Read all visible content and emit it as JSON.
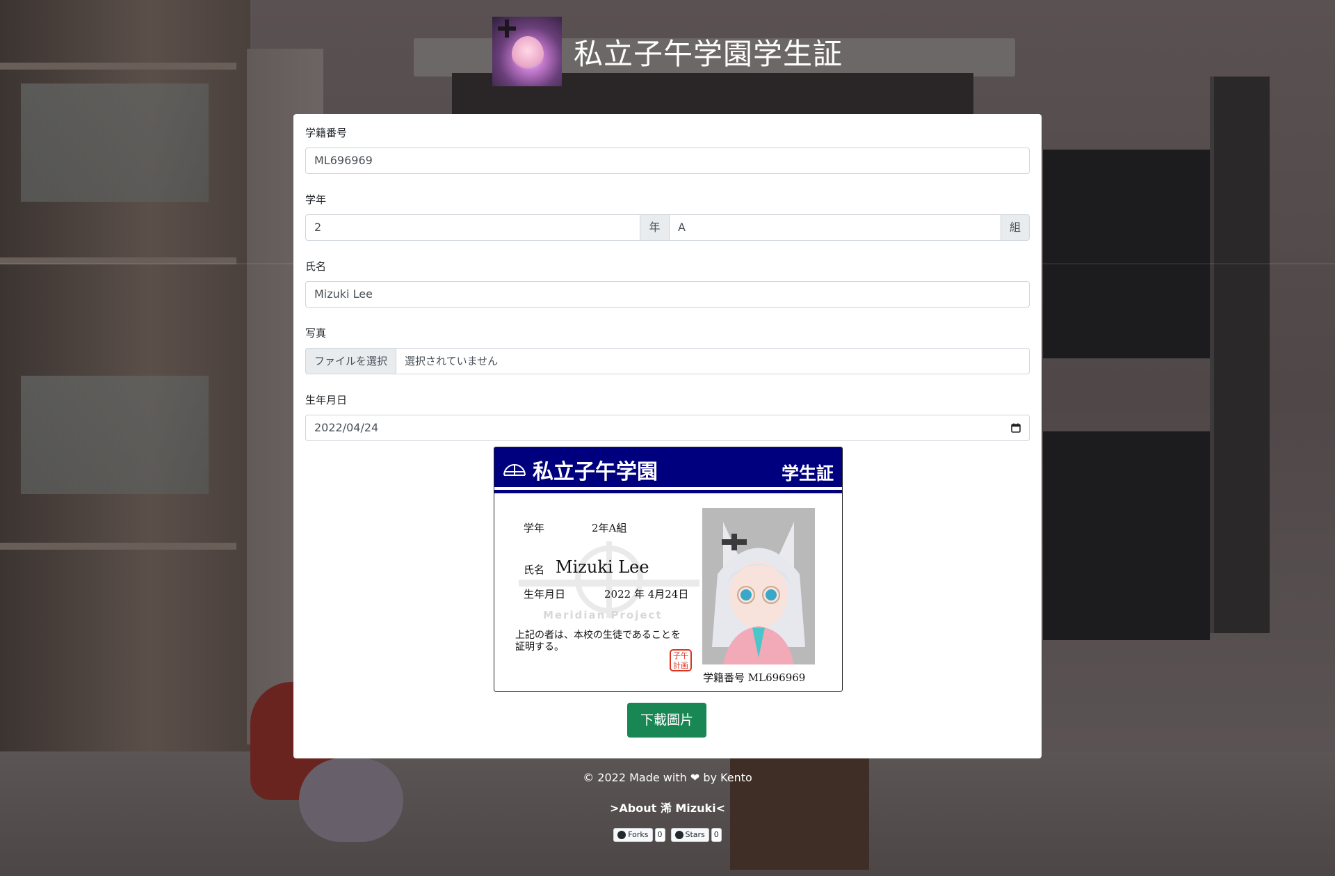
{
  "header": {
    "title": "私立子午学園学生証"
  },
  "form": {
    "student_no_label": "学籍番号",
    "student_no_value": "ML696969",
    "grade_label": "学年",
    "grade_value": "2",
    "grade_unit": "年",
    "class_value": "A",
    "class_unit": "組",
    "name_label": "氏名",
    "name_value": "Mizuki Lee",
    "photo_label": "写真",
    "photo_button": "ファイルを選択",
    "photo_status": "選択されていません",
    "birth_label": "生年月日",
    "birth_value": "2022/04/24"
  },
  "idcard": {
    "school": "私立子午学園",
    "kind": "学生証",
    "grade_key": "学年",
    "grade_val": "2年A組",
    "name_key": "氏名",
    "name_val": "Mizuki Lee",
    "birth_key": "生年月日",
    "birth_val": "2022 年 4月24日",
    "watermark_text": "Meridian Project",
    "note_line1": "上記の者は、本校の生徒であることを",
    "note_line2": "証明する。",
    "stamp": "子午計画",
    "photo_no": "学籍番号 ML696969"
  },
  "download_button": "下載圖片",
  "footer": {
    "made_with": "© 2022 Made with ❤ by Kento",
    "about": ">About 浠 Mizuki<",
    "forks_label": "Forks",
    "forks_count": "0",
    "stars_label": "Stars",
    "stars_count": "0"
  },
  "colors": {
    "idcard_header": "#00007f",
    "download_button": "#198754"
  }
}
